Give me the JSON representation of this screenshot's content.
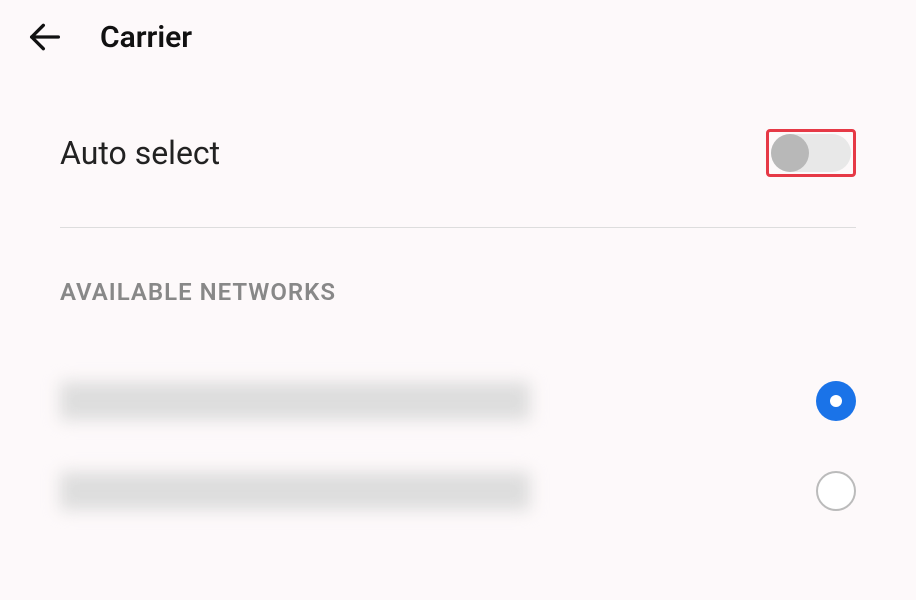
{
  "header": {
    "title": "Carrier"
  },
  "autoSelect": {
    "label": "Auto select",
    "enabled": false,
    "highlighted": true
  },
  "networksSection": {
    "header": "AVAILABLE NETWORKS"
  },
  "networks": [
    {
      "name": "[redacted]",
      "selected": true
    },
    {
      "name": "[redacted]",
      "selected": false
    }
  ]
}
